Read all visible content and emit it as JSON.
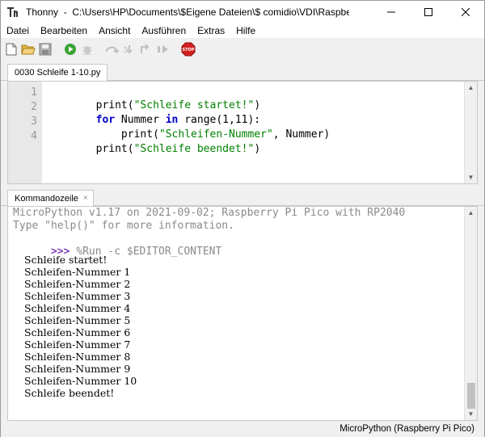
{
  "window": {
    "app_name": "Thonny",
    "path": "C:\\Users\\HP\\Documents\\$Eigene Dateien\\$ comidio\\VDI\\Raspberry Pi\\Pico\\Pico P..."
  },
  "menu": [
    "Datei",
    "Bearbeiten",
    "Ansicht",
    "Ausführen",
    "Extras",
    "Hilfe"
  ],
  "toolbar": {
    "buttons": [
      "new-file",
      "open-file",
      "save-file",
      "run",
      "debug",
      "step-over",
      "step-into",
      "step-out",
      "resume",
      "stop"
    ],
    "stop_label": "STOP"
  },
  "editor": {
    "tab_label": "0030 Schleife 1-10.py",
    "line_numbers": [
      "1",
      "2",
      "3",
      "4"
    ],
    "lines": [
      [
        {
          "t": "print",
          "c": "fn"
        },
        {
          "t": "(",
          "c": "fn"
        },
        {
          "t": "\"Schleife startet!\"",
          "c": "str"
        },
        {
          "t": ")",
          "c": "fn"
        }
      ],
      [
        {
          "t": "for",
          "c": "kw"
        },
        {
          "t": " Nummer ",
          "c": "fn"
        },
        {
          "t": "in",
          "c": "kw"
        },
        {
          "t": " range(1,11):",
          "c": "fn"
        }
      ],
      [
        {
          "t": "    print(",
          "c": "fn"
        },
        {
          "t": "\"Schleifen-Nummer\"",
          "c": "str"
        },
        {
          "t": ", Nummer)",
          "c": "fn"
        }
      ],
      [
        {
          "t": "print(",
          "c": "fn"
        },
        {
          "t": "\"Schleife beendet!\"",
          "c": "str"
        },
        {
          "t": ")",
          "c": "fn"
        }
      ]
    ]
  },
  "shell": {
    "tab_label": "Kommandozeile",
    "tab_close": "×",
    "banner_1": "MicroPython v1.17 on 2021-09-02; Raspberry Pi Pico with RP2040",
    "banner_2": "Type \"help()\" for more information.",
    "prompt": ">>>",
    "command": " %Run -c $EDITOR_CONTENT",
    "output": [
      "Schleife startet!",
      "Schleifen-Nummer 1",
      "Schleifen-Nummer 2",
      "Schleifen-Nummer 3",
      "Schleifen-Nummer 4",
      "Schleifen-Nummer 5",
      "Schleifen-Nummer 6",
      "Schleifen-Nummer 7",
      "Schleifen-Nummer 8",
      "Schleifen-Nummer 9",
      "Schleifen-Nummer 10",
      "Schleife beendet!"
    ],
    "final_prompt": ">>>"
  },
  "status": {
    "interpreter": "MicroPython (Raspberry Pi Pico)"
  },
  "colors": {
    "keyword": "#0000c8",
    "string": "#008000",
    "prompt": "#7b3fb1",
    "stop": "#d22020"
  }
}
